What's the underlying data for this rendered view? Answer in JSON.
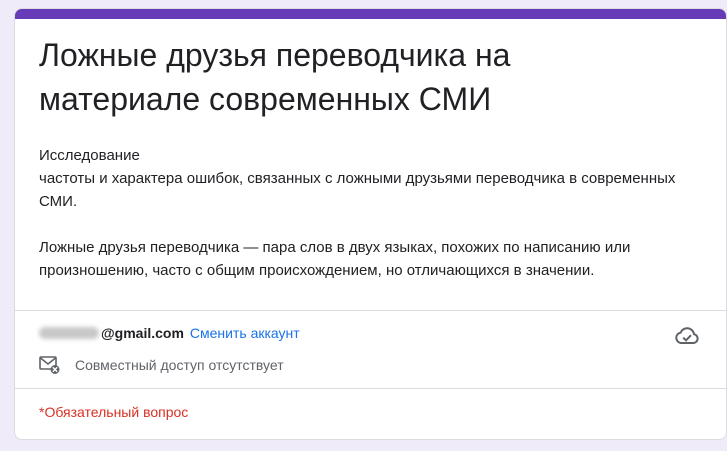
{
  "form": {
    "title": "Ложные друзья переводчика на материале современных СМИ",
    "description": "Исследование\nчастоты и характера ошибок, связанных с ложными друзьями переводчика в современных СМИ.\n\nЛожные друзья переводчика — пара слов в двух языках, похожих по написанию или произношению, часто с общим происхождением, но отличающихся в значении."
  },
  "account": {
    "email_domain": "@gmail.com",
    "switch_label": "Сменить аккаунт",
    "sharing_status": "Совместный доступ отсутствует",
    "cloud_icon": "cloud-check-icon",
    "mail_icon": "mail-off-icon"
  },
  "required_note": "*Обязательный вопрос",
  "colors": {
    "accent": "#673ab7",
    "page_background": "#f0ebf8",
    "link": "#1a73e8",
    "required": "#d93025"
  }
}
